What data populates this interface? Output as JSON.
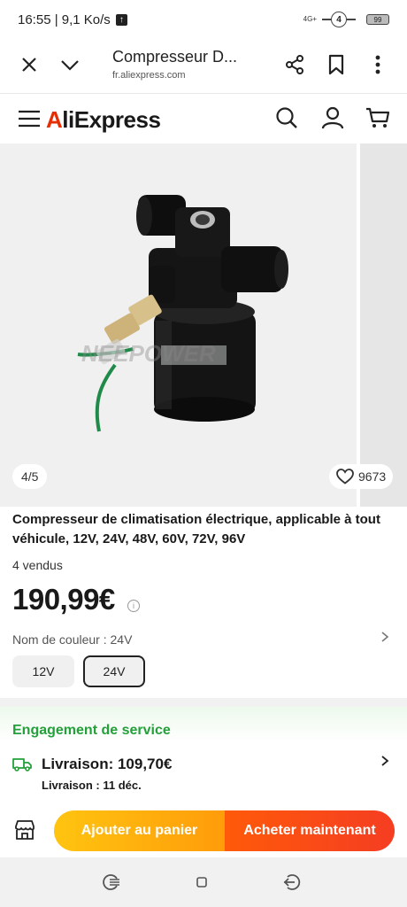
{
  "status_bar": {
    "time_speed": "16:55 | 9,1 Ko/s",
    "network": "4G+",
    "signal_badge": "4",
    "battery": "99"
  },
  "browser": {
    "tab_title": "Compresseur D...",
    "url": "fr.aliexpress.com",
    "icons": [
      "close-icon",
      "chevron-down-icon",
      "share-icon",
      "bookmark-icon",
      "more-vertical-icon"
    ]
  },
  "site_header": {
    "logo_a": "A",
    "logo_rest": "liExpress",
    "icons": [
      "menu-icon",
      "search-icon",
      "account-icon",
      "cart-icon"
    ]
  },
  "gallery": {
    "counter": "4/5",
    "wishlist_count": "9673",
    "watermark": "NEEPOWER"
  },
  "product": {
    "title": "Compresseur de climatisation électrique, applicable à tout véhicule, 12V, 24V, 48V, 60V, 72V, 96V",
    "sold": "4 vendus",
    "price": "190,99€",
    "color_label": "Nom de couleur : 24V",
    "variants": [
      "12V",
      "24V"
    ],
    "selected_variant": "24V"
  },
  "service": {
    "title": "Engagement de service",
    "shipping_title": "Livraison: 109,70€",
    "shipping_date_label": "Livraison : ",
    "shipping_date": "11 déc."
  },
  "actions": {
    "add_to_cart": "Ajouter au panier",
    "buy_now": "Acheter maintenant"
  },
  "colors": {
    "accent_red": "#e62e04",
    "cart_orange": "#ffb00e",
    "buy_red": "#f5461a",
    "service_green": "#23a03a"
  }
}
